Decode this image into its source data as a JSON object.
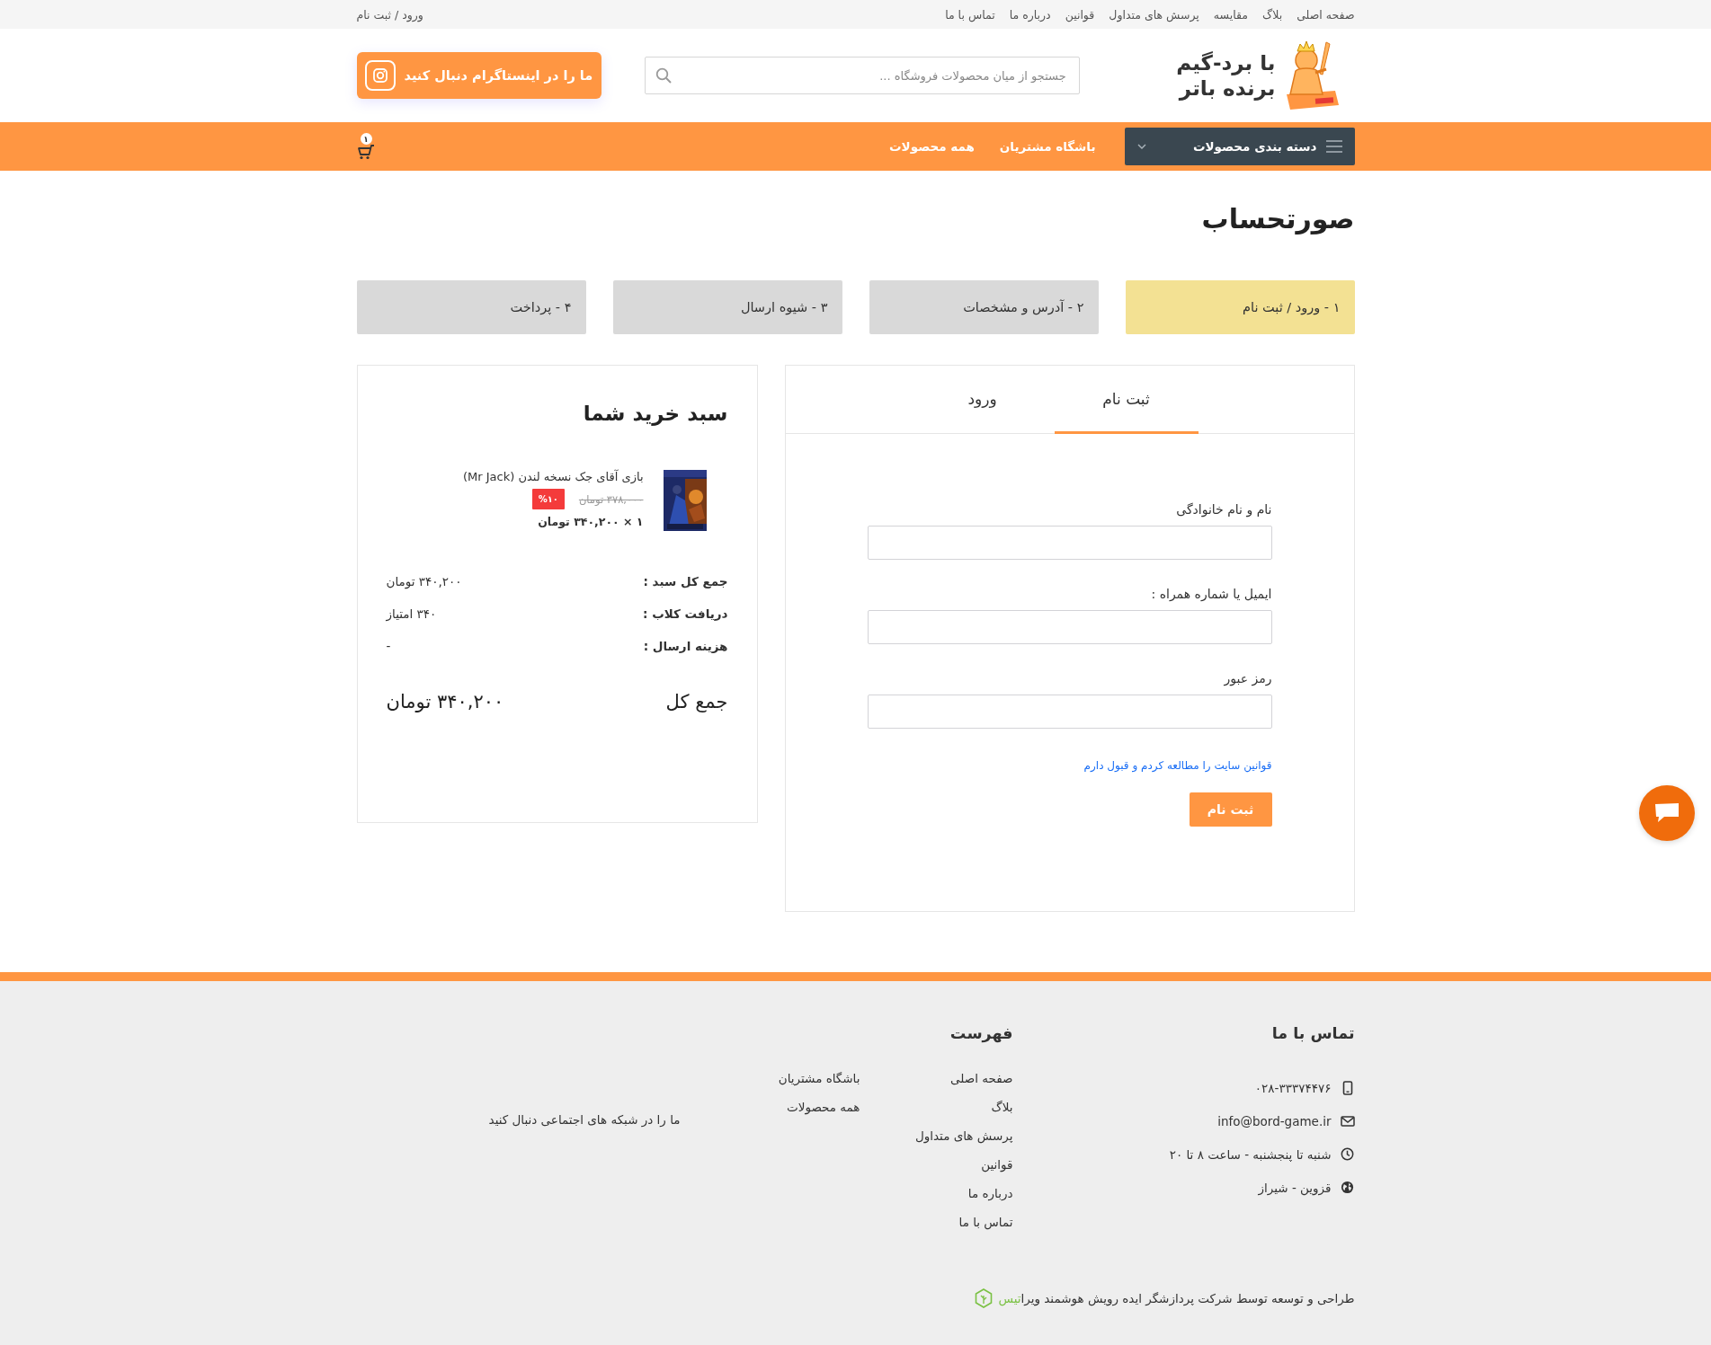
{
  "top_bar": {
    "links": [
      "صفحه اصلی",
      "بلاگ",
      "مقایسه",
      "پرسش های متداول",
      "قوانین",
      "درباره ما",
      "تماس با ما"
    ],
    "account_link": "ورود / ثبت نام"
  },
  "header": {
    "logo_lines": [
      "با برد-گیم",
      "برنده باتر"
    ],
    "search": {
      "placeholder": "جستجو از میان محصولات فروشگاه ..."
    },
    "instagram_button": "ما را در اینستاگرام دنبال کنید"
  },
  "nav": {
    "categories_button": "دسته بندی محصولات",
    "links": [
      "باشگاه مشتریان",
      "همه محصولات"
    ],
    "cart_count": "۱"
  },
  "page_title": "صورتحساب",
  "steps": [
    {
      "label": "۱ - ورود / ثبت نام",
      "selected": true
    },
    {
      "label": "۲ - آدرس و مشخصات",
      "selected": false
    },
    {
      "label": "۳ - شیوه ارسال",
      "selected": false
    },
    {
      "label": "۴ - پرداخت",
      "selected": false
    }
  ],
  "auth": {
    "tabs": [
      {
        "label": "ثبت نام",
        "selected": true
      },
      {
        "label": "ورود",
        "selected": false
      }
    ],
    "fields": [
      {
        "label": "نام و نام خانوادگی"
      },
      {
        "label": "ایمیل یا شماره همراه :"
      },
      {
        "label": "رمز عبور"
      }
    ],
    "terms_link": "قوانین سایت را مطالعه کردم و قبول دارم",
    "submit": "ثبت نام"
  },
  "cart": {
    "title": "سبد خرید شما",
    "items": [
      {
        "name": "بازی آقای جک نسخه لندن (Mr Jack)",
        "old_price": "۳۷۸,۰۰۰ تومان",
        "discount": "%۱۰",
        "quantity_price": "۱ × ۳۴۰,۲۰۰ تومان"
      }
    ],
    "summary": [
      {
        "label": "جمع کل سبد :",
        "value": "۳۴۰,۲۰۰ تومان"
      },
      {
        "label": "دریافت کلاب :",
        "value": "۳۴۰ امتیاز"
      },
      {
        "label": "هزینه ارسال :",
        "value": "-"
      }
    ],
    "total": {
      "label": "جمع کل",
      "value": "۳۴۰,۲۰۰ تومان"
    }
  },
  "footer": {
    "contact": {
      "title": "تماس با ما",
      "items": [
        {
          "kind": "phone",
          "text": "۰۲۸-۳۳۳۷۴۴۷۶"
        },
        {
          "kind": "email",
          "text": "info@bord-game.ir"
        },
        {
          "kind": "hours",
          "text": "شنبه تا پنجشنبه - ساعت ۸ تا ۲۰"
        },
        {
          "kind": "location",
          "text": "قزوین - شیراز"
        }
      ]
    },
    "menu": {
      "title": "فهرست",
      "columns": [
        [
          "صفحه اصلی",
          "بلاگ",
          "پرسش های متداول",
          "قوانین",
          "درباره ما",
          "تماس با ما"
        ],
        [
          "باشگاه مشتریان",
          "همه محصولات"
        ]
      ]
    },
    "social_text": "ما را در شبکه های اجتماعی دنبال کنید",
    "credit": {
      "text": "طراحی و توسعه توسط شرکت پردازشگر ایده رویش هوشمند ویرا",
      "brand": "تیس"
    }
  }
}
